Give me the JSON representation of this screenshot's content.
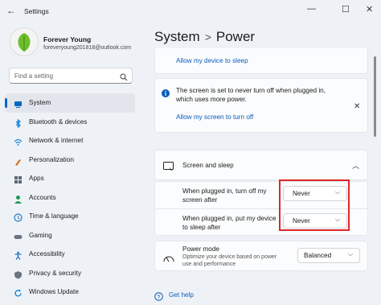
{
  "window": {
    "title": "Settings",
    "back_glyph": "←",
    "minimize_glyph": "—",
    "maximize_glyph": "☐",
    "close_glyph": "✕"
  },
  "user": {
    "name": "Forever Young",
    "email": "foreveryoung201818@outlook.com"
  },
  "search": {
    "placeholder": "Find a setting"
  },
  "nav": [
    {
      "label": "System",
      "icon": "monitor-icon",
      "color": "#0067c0",
      "active": true
    },
    {
      "label": "Bluetooth & devices",
      "icon": "bluetooth-icon",
      "color": "#0a7bd6"
    },
    {
      "label": "Network & internet",
      "icon": "wifi-icon",
      "color": "#2a88d8"
    },
    {
      "label": "Personalization",
      "icon": "brush-icon",
      "color": "#d0731c"
    },
    {
      "label": "Apps",
      "icon": "apps-icon",
      "color": "#5b6673"
    },
    {
      "label": "Accounts",
      "icon": "person-icon",
      "color": "#1c9a5a"
    },
    {
      "label": "Time & language",
      "icon": "globe-clock-icon",
      "color": "#2677c9"
    },
    {
      "label": "Gaming",
      "icon": "controller-icon",
      "color": "#6b7480"
    },
    {
      "label": "Accessibility",
      "icon": "accessibility-icon",
      "color": "#1f6fc2"
    },
    {
      "label": "Privacy & security",
      "icon": "shield-icon",
      "color": "#6b7480"
    },
    {
      "label": "Windows Update",
      "icon": "update-icon",
      "color": "#0a7bd6"
    }
  ],
  "breadcrumb": {
    "parent": "System",
    "separator": ">",
    "current": "Power"
  },
  "content": {
    "sleep_link": "Allow my device to sleep",
    "notice_text": "The screen is set to never turn off when plugged in, which uses more power.",
    "screen_link": "Allow my screen to turn off",
    "screen_sleep": {
      "title": "Screen and sleep",
      "rows": [
        {
          "label": "When plugged in, turn off my screen after",
          "value": "Never"
        },
        {
          "label": "When plugged in, put my device to sleep after",
          "value": "Never"
        }
      ]
    },
    "power_mode": {
      "title": "Power mode",
      "desc": "Optimize your device based on power use and performance",
      "value": "Balanced"
    },
    "help_link": "Get help"
  },
  "colors": {
    "accent": "#0067c0",
    "highlight": "#e0262b",
    "link": "#0a5cb8"
  }
}
